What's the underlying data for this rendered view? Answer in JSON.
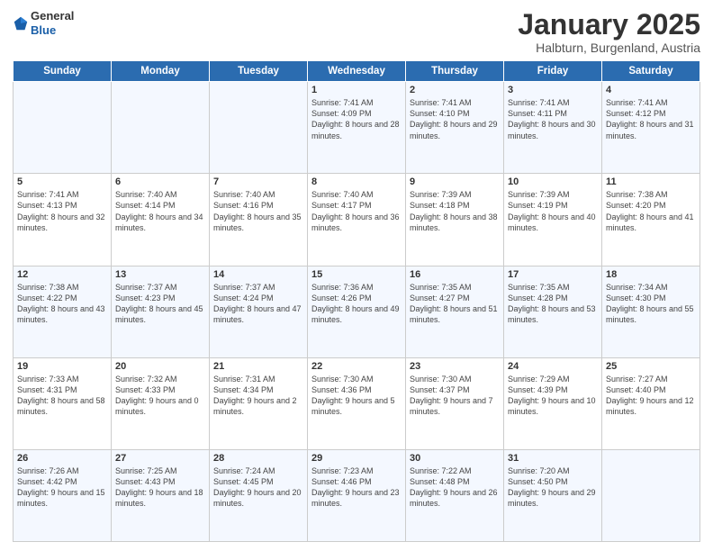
{
  "header": {
    "logo": {
      "line1": "General",
      "line2": "Blue"
    },
    "title": "January 2025",
    "subtitle": "Halbturn, Burgenland, Austria"
  },
  "days_of_week": [
    "Sunday",
    "Monday",
    "Tuesday",
    "Wednesday",
    "Thursday",
    "Friday",
    "Saturday"
  ],
  "weeks": [
    [
      {
        "day": "",
        "info": ""
      },
      {
        "day": "",
        "info": ""
      },
      {
        "day": "",
        "info": ""
      },
      {
        "day": "1",
        "info": "Sunrise: 7:41 AM\nSunset: 4:09 PM\nDaylight: 8 hours and 28 minutes."
      },
      {
        "day": "2",
        "info": "Sunrise: 7:41 AM\nSunset: 4:10 PM\nDaylight: 8 hours and 29 minutes."
      },
      {
        "day": "3",
        "info": "Sunrise: 7:41 AM\nSunset: 4:11 PM\nDaylight: 8 hours and 30 minutes."
      },
      {
        "day": "4",
        "info": "Sunrise: 7:41 AM\nSunset: 4:12 PM\nDaylight: 8 hours and 31 minutes."
      }
    ],
    [
      {
        "day": "5",
        "info": "Sunrise: 7:41 AM\nSunset: 4:13 PM\nDaylight: 8 hours and 32 minutes."
      },
      {
        "day": "6",
        "info": "Sunrise: 7:40 AM\nSunset: 4:14 PM\nDaylight: 8 hours and 34 minutes."
      },
      {
        "day": "7",
        "info": "Sunrise: 7:40 AM\nSunset: 4:16 PM\nDaylight: 8 hours and 35 minutes."
      },
      {
        "day": "8",
        "info": "Sunrise: 7:40 AM\nSunset: 4:17 PM\nDaylight: 8 hours and 36 minutes."
      },
      {
        "day": "9",
        "info": "Sunrise: 7:39 AM\nSunset: 4:18 PM\nDaylight: 8 hours and 38 minutes."
      },
      {
        "day": "10",
        "info": "Sunrise: 7:39 AM\nSunset: 4:19 PM\nDaylight: 8 hours and 40 minutes."
      },
      {
        "day": "11",
        "info": "Sunrise: 7:38 AM\nSunset: 4:20 PM\nDaylight: 8 hours and 41 minutes."
      }
    ],
    [
      {
        "day": "12",
        "info": "Sunrise: 7:38 AM\nSunset: 4:22 PM\nDaylight: 8 hours and 43 minutes."
      },
      {
        "day": "13",
        "info": "Sunrise: 7:37 AM\nSunset: 4:23 PM\nDaylight: 8 hours and 45 minutes."
      },
      {
        "day": "14",
        "info": "Sunrise: 7:37 AM\nSunset: 4:24 PM\nDaylight: 8 hours and 47 minutes."
      },
      {
        "day": "15",
        "info": "Sunrise: 7:36 AM\nSunset: 4:26 PM\nDaylight: 8 hours and 49 minutes."
      },
      {
        "day": "16",
        "info": "Sunrise: 7:35 AM\nSunset: 4:27 PM\nDaylight: 8 hours and 51 minutes."
      },
      {
        "day": "17",
        "info": "Sunrise: 7:35 AM\nSunset: 4:28 PM\nDaylight: 8 hours and 53 minutes."
      },
      {
        "day": "18",
        "info": "Sunrise: 7:34 AM\nSunset: 4:30 PM\nDaylight: 8 hours and 55 minutes."
      }
    ],
    [
      {
        "day": "19",
        "info": "Sunrise: 7:33 AM\nSunset: 4:31 PM\nDaylight: 8 hours and 58 minutes."
      },
      {
        "day": "20",
        "info": "Sunrise: 7:32 AM\nSunset: 4:33 PM\nDaylight: 9 hours and 0 minutes."
      },
      {
        "day": "21",
        "info": "Sunrise: 7:31 AM\nSunset: 4:34 PM\nDaylight: 9 hours and 2 minutes."
      },
      {
        "day": "22",
        "info": "Sunrise: 7:30 AM\nSunset: 4:36 PM\nDaylight: 9 hours and 5 minutes."
      },
      {
        "day": "23",
        "info": "Sunrise: 7:30 AM\nSunset: 4:37 PM\nDaylight: 9 hours and 7 minutes."
      },
      {
        "day": "24",
        "info": "Sunrise: 7:29 AM\nSunset: 4:39 PM\nDaylight: 9 hours and 10 minutes."
      },
      {
        "day": "25",
        "info": "Sunrise: 7:27 AM\nSunset: 4:40 PM\nDaylight: 9 hours and 12 minutes."
      }
    ],
    [
      {
        "day": "26",
        "info": "Sunrise: 7:26 AM\nSunset: 4:42 PM\nDaylight: 9 hours and 15 minutes."
      },
      {
        "day": "27",
        "info": "Sunrise: 7:25 AM\nSunset: 4:43 PM\nDaylight: 9 hours and 18 minutes."
      },
      {
        "day": "28",
        "info": "Sunrise: 7:24 AM\nSunset: 4:45 PM\nDaylight: 9 hours and 20 minutes."
      },
      {
        "day": "29",
        "info": "Sunrise: 7:23 AM\nSunset: 4:46 PM\nDaylight: 9 hours and 23 minutes."
      },
      {
        "day": "30",
        "info": "Sunrise: 7:22 AM\nSunset: 4:48 PM\nDaylight: 9 hours and 26 minutes."
      },
      {
        "day": "31",
        "info": "Sunrise: 7:20 AM\nSunset: 4:50 PM\nDaylight: 9 hours and 29 minutes."
      },
      {
        "day": "",
        "info": ""
      }
    ]
  ]
}
